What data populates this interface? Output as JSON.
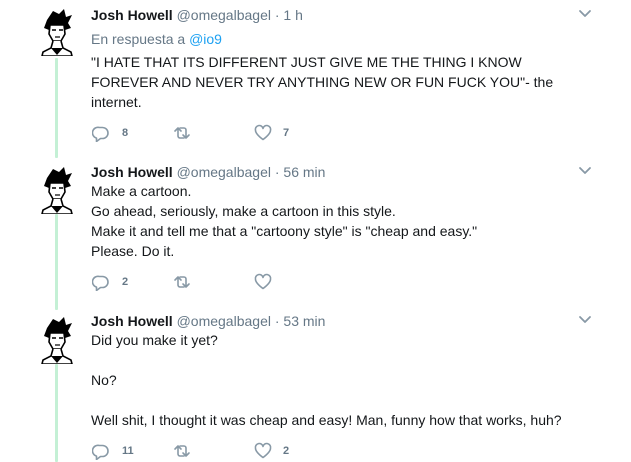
{
  "colors": {
    "thread_line": "#c4f0d5",
    "mention": "#1da1f2",
    "secondary_text": "#657786",
    "icon": "#8899a6"
  },
  "icons": {
    "reply": "reply-icon",
    "retweet": "retweet-icon",
    "like": "heart-icon",
    "menu": "chevron-down-icon"
  },
  "tweets": [
    {
      "name": "Josh Howell",
      "handle": "@omegalbagel",
      "separator": "·",
      "time": "1 h",
      "reply_prefix": "En respuesta a",
      "reply_mention": "@io9",
      "text": "\"I HATE THAT ITS DIFFERENT JUST GIVE ME THE THING I KNOW FOREVER AND NEVER TRY ANYTHING NEW OR FUN FUCK YOU\"- the internet.",
      "replies": "8",
      "retweets": "",
      "likes": "7"
    },
    {
      "name": "Josh Howell",
      "handle": "@omegalbagel",
      "separator": "·",
      "time": "56 min",
      "text": "Make a cartoon.\nGo ahead, seriously, make a cartoon in this style.\nMake it and tell me that a \"cartoony style\" is \"cheap and easy.\"\nPlease. Do it.",
      "replies": "2",
      "retweets": "",
      "likes": ""
    },
    {
      "name": "Josh Howell",
      "handle": "@omegalbagel",
      "separator": "·",
      "time": "53 min",
      "text": "Did you make it yet?\n\nNo?\n\nWell shit, I thought it was cheap and easy! Man, funny how that works, huh?",
      "replies": "11",
      "retweets": "",
      "likes": "2"
    }
  ]
}
